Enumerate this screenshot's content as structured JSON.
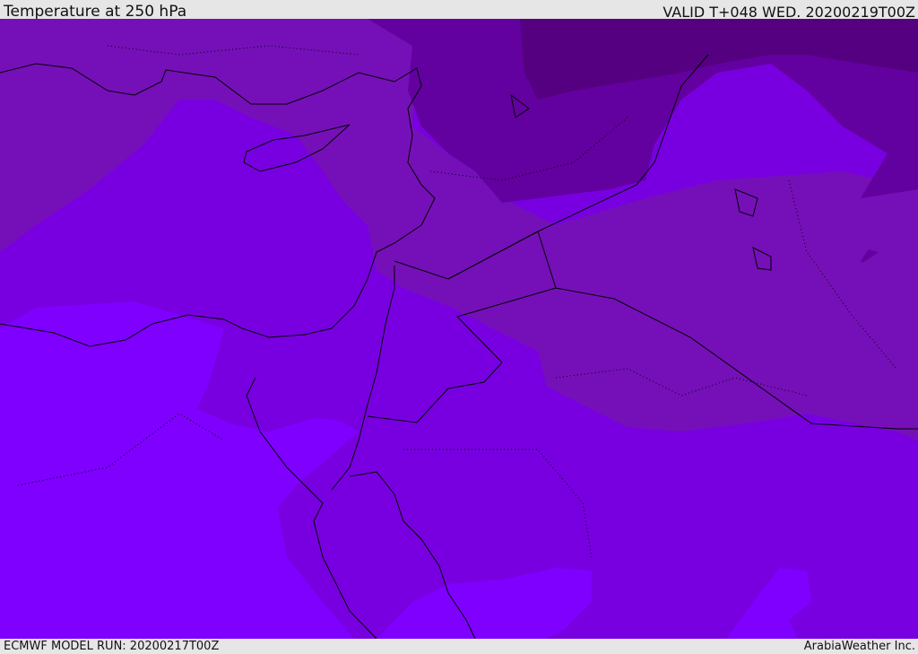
{
  "header": {
    "title": "Temperature at 250 hPa",
    "valid_time": "VALID T+048 WED. 20200219T00Z"
  },
  "footer": {
    "model_run": "ECMWF MODEL RUN: 20200217T00Z",
    "credit": "ArabiaWeather Inc."
  },
  "colors": {
    "band_warmest": "#7f00ff",
    "band_2": "#7800e0",
    "band_3": "#7510b8",
    "band_4": "#6300a0",
    "band_coldest": "#540080",
    "coastline": "#000000"
  }
}
